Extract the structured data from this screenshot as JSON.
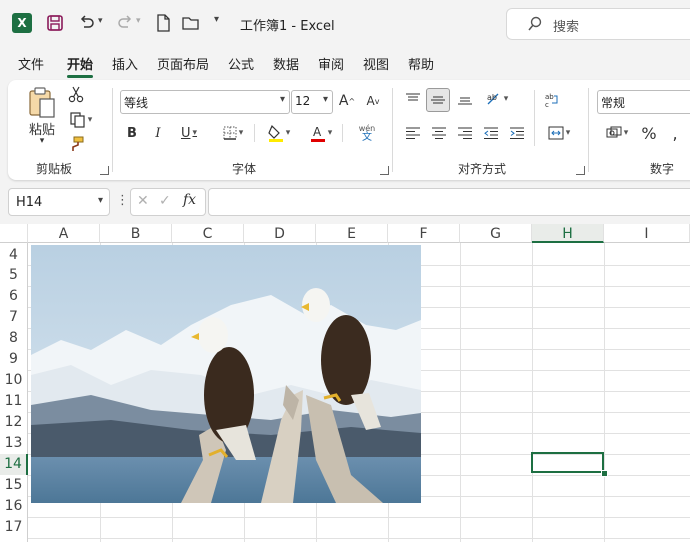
{
  "titlebar": {
    "title": "工作簿1  -  Excel",
    "search_label": "搜索"
  },
  "tabs": [
    "文件",
    "开始",
    "插入",
    "页面布局",
    "公式",
    "数据",
    "审阅",
    "视图",
    "帮助"
  ],
  "active_tab": "开始",
  "ribbon": {
    "clipboard": {
      "paste_label": "粘贴",
      "group_label": "剪贴板"
    },
    "font": {
      "font_name": "等线",
      "font_size": "12",
      "group_label": "字体",
      "phonetic_label": "wén"
    },
    "alignment": {
      "group_label": "对齐方式"
    },
    "number": {
      "format": "常规",
      "group_label": "数字"
    }
  },
  "formula_bar": {
    "name_box": "H14",
    "fx_label": "fx",
    "formula": ""
  },
  "sheet": {
    "columns": [
      "A",
      "B",
      "C",
      "D",
      "E",
      "F",
      "G",
      "H",
      "I"
    ],
    "rows": [
      "4",
      "5",
      "6",
      "7",
      "8",
      "9",
      "10",
      "11",
      "12",
      "13",
      "14",
      "15",
      "16",
      "17"
    ],
    "selected_column": "H",
    "selected_row": "14",
    "picture_subject": "two bald eagles perched on driftwood with snowy mountains"
  },
  "colors": {
    "accent": "#1d6f42"
  }
}
